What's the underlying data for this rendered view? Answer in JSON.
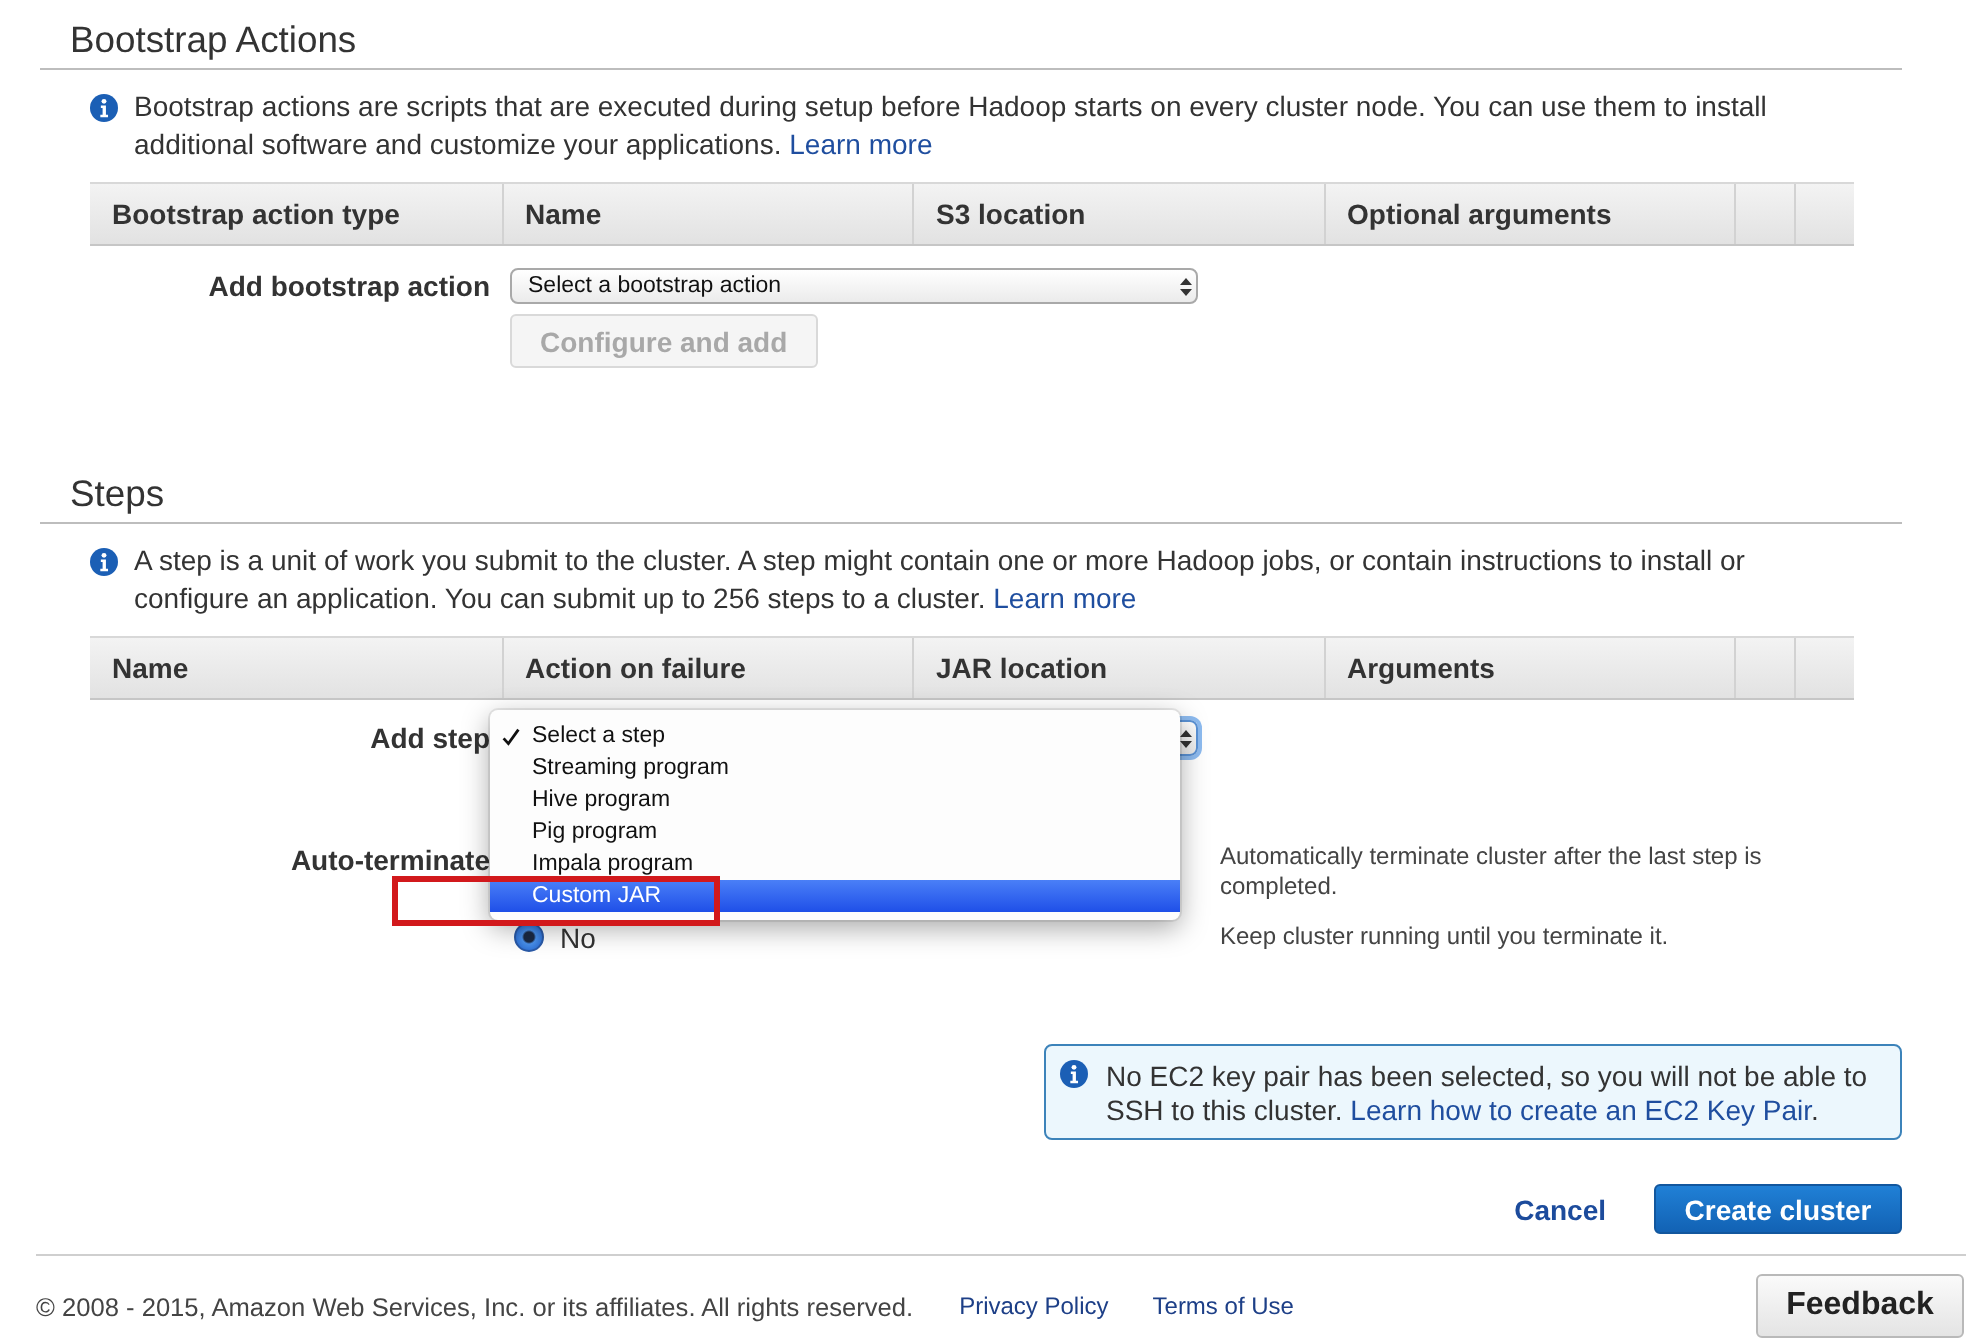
{
  "bootstrap_actions": {
    "title": "Bootstrap Actions",
    "info": "Bootstrap actions are scripts that are executed during setup before Hadoop starts on every cluster node. You can use them to install additional software and customize your applications.",
    "info_link": "Learn more",
    "columns": [
      "Bootstrap action type",
      "Name",
      "S3 location",
      "Optional arguments"
    ],
    "add_label": "Add bootstrap action",
    "select": {
      "value": "Select a bootstrap action"
    },
    "configure_button": {
      "label": "Configure and add",
      "disabled": true
    }
  },
  "steps": {
    "title": "Steps",
    "info": "A step is a unit of work you submit to the cluster. A step might contain one or more Hadoop jobs, or contain instructions to install or configure an application. You can submit up to 256 steps to a cluster.",
    "info_link": "Learn more",
    "columns": [
      "Name",
      "Action on failure",
      "JAR location",
      "Arguments"
    ],
    "add_label": "Add step",
    "step_select": {
      "focused": true
    },
    "step_menu": {
      "items": [
        {
          "label": "Select a step",
          "selected": true,
          "highlighted": false
        },
        {
          "label": "Streaming program",
          "selected": false,
          "highlighted": false
        },
        {
          "label": "Hive program",
          "selected": false,
          "highlighted": false
        },
        {
          "label": "Pig program",
          "selected": false,
          "highlighted": false
        },
        {
          "label": "Impala program",
          "selected": false,
          "highlighted": false
        },
        {
          "label": "Custom JAR",
          "selected": false,
          "highlighted": true
        }
      ]
    },
    "auto_terminate": {
      "label": "Auto-terminate",
      "options": [
        {
          "description": "Automatically terminate cluster after the last step is completed."
        },
        {
          "label": "No",
          "selected": true,
          "description": "Keep cluster running until you terminate it."
        }
      ]
    }
  },
  "key_pair_notice": {
    "text": "No EC2 key pair has been selected, so you will not be able to SSH to this cluster.",
    "link": "Learn how to create an EC2 Key Pair",
    "text_after": "."
  },
  "actions": {
    "cancel": "Cancel",
    "create": "Create cluster"
  },
  "footer": {
    "copyright": "© 2008 - 2015, Amazon Web Services, Inc. or its affiliates. All rights reserved.",
    "links": [
      "Privacy Policy",
      "Terms of Use"
    ],
    "feedback": "Feedback"
  }
}
